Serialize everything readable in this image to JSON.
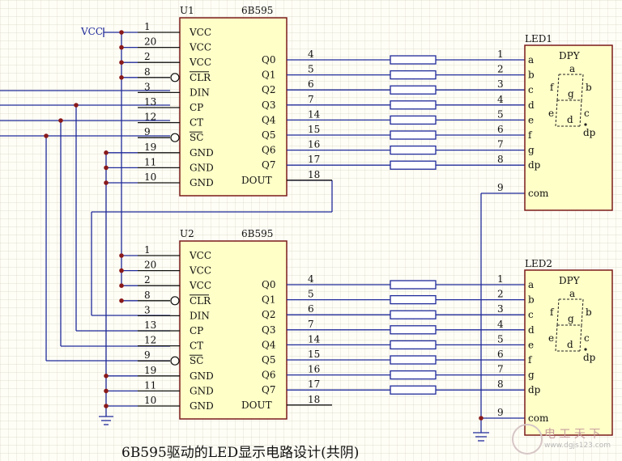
{
  "caption": "6B595驱动的LED显示电路设计(共阴)",
  "vcc_label": "VCC",
  "chips": [
    {
      "ref": "U1",
      "part": "6B595"
    },
    {
      "ref": "U2",
      "part": "6B595"
    }
  ],
  "left_pins": [
    {
      "num": "1",
      "name": "VCC"
    },
    {
      "num": "20",
      "name": "VCC"
    },
    {
      "num": "2",
      "name": "VCC"
    },
    {
      "num": "8",
      "name": "CLR"
    },
    {
      "num": "3",
      "name": "DIN"
    },
    {
      "num": "13",
      "name": "CP"
    },
    {
      "num": "12",
      "name": "CT"
    },
    {
      "num": "9",
      "name": "SC"
    },
    {
      "num": "19",
      "name": "GND"
    },
    {
      "num": "11",
      "name": "GND"
    },
    {
      "num": "10",
      "name": "GND"
    }
  ],
  "right_pins": [
    {
      "num": "4",
      "name": "Q0"
    },
    {
      "num": "5",
      "name": "Q1"
    },
    {
      "num": "6",
      "name": "Q2"
    },
    {
      "num": "7",
      "name": "Q3"
    },
    {
      "num": "14",
      "name": "Q4"
    },
    {
      "num": "15",
      "name": "Q5"
    },
    {
      "num": "16",
      "name": "Q6"
    },
    {
      "num": "17",
      "name": "Q7"
    },
    {
      "num": "18",
      "name": "DOUT"
    }
  ],
  "leds": [
    {
      "ref": "LED1",
      "type": "DPY"
    },
    {
      "ref": "LED2",
      "type": "DPY"
    }
  ],
  "led_pins": [
    {
      "num": "1",
      "name": "a"
    },
    {
      "num": "2",
      "name": "b"
    },
    {
      "num": "3",
      "name": "c"
    },
    {
      "num": "4",
      "name": "d"
    },
    {
      "num": "5",
      "name": "e"
    },
    {
      "num": "6",
      "name": "f"
    },
    {
      "num": "7",
      "name": "g"
    },
    {
      "num": "8",
      "name": "dp"
    },
    {
      "num": "9",
      "name": "com"
    }
  ],
  "segment_labels": {
    "a": "a",
    "b": "b",
    "c": "c",
    "d": "d",
    "e": "e",
    "f": "f",
    "g": "g",
    "dp": "dp"
  },
  "watermark": {
    "cn": "电 工 天 下",
    "url": "www.dgjs123.com"
  }
}
